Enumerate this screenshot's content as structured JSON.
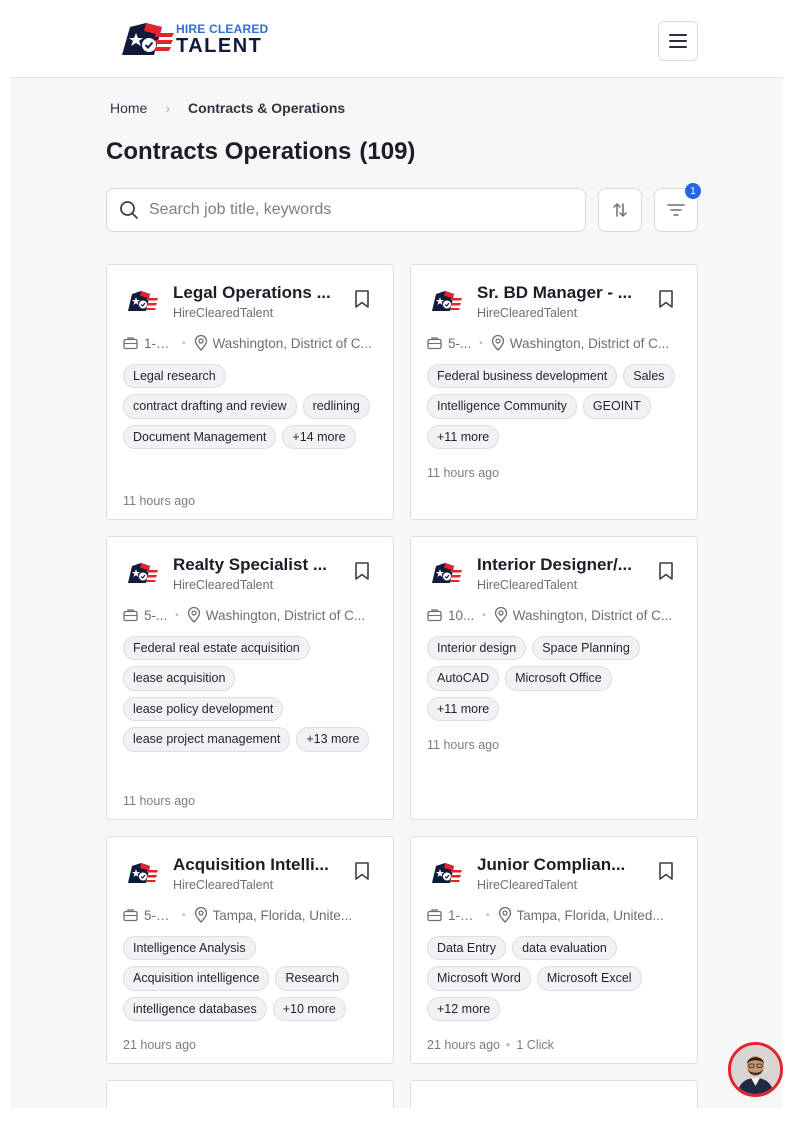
{
  "brand": {
    "line1": "HIRE CLEARED",
    "line2": "TALENT"
  },
  "breadcrumb": {
    "home": "Home",
    "separator": "›",
    "current": "Contracts & Operations"
  },
  "page": {
    "title": "Contracts Operations",
    "count": "(109)"
  },
  "search": {
    "placeholder": "Search job title, keywords"
  },
  "filter": {
    "badge": "1"
  },
  "colors": {
    "accent": "#2563eb",
    "brand_navy": "#0f1b3d",
    "brand_blue": "#2f6fd1",
    "brand_red": "#e0262c"
  },
  "cards": [
    {
      "title": "Legal Operations ...",
      "company": "HireClearedTalent",
      "experience": "1-3...",
      "location": "Washington, District of C...",
      "tags": [
        "Legal research",
        "contract drafting and review",
        "redlining",
        "Document Management",
        "+14 more"
      ],
      "posted": "11 hours ago",
      "extra": ""
    },
    {
      "title": "Sr. BD Manager - ...",
      "company": "HireClearedTalent",
      "experience": "5-...",
      "location": "Washington, District of C...",
      "tags": [
        "Federal business development",
        "Sales",
        "Intelligence Community",
        "GEOINT",
        "+11 more"
      ],
      "posted": "11 hours ago",
      "extra": ""
    },
    {
      "title": "Realty Specialist ...",
      "company": "HireClearedTalent",
      "experience": "5-...",
      "location": "Washington, District of C...",
      "tags": [
        "Federal real estate acquisition",
        "lease acquisition",
        "lease policy development",
        "lease project management",
        "+13 more"
      ],
      "posted": "11 hours ago",
      "extra": ""
    },
    {
      "title": "Interior Designer/...",
      "company": "HireClearedTalent",
      "experience": "10...",
      "location": "Washington, District of C...",
      "tags": [
        "Interior design",
        "Space Planning",
        "AutoCAD",
        "Microsoft Office",
        "+11 more"
      ],
      "posted": "11 hours ago",
      "extra": ""
    },
    {
      "title": "Acquisition Intelli...",
      "company": "HireClearedTalent",
      "experience": "5-7 y...",
      "location": "Tampa, Florida, Unite...",
      "tags": [
        "Intelligence Analysis",
        "Acquisition intelligence",
        "Research",
        "intelligence databases",
        "+10 more"
      ],
      "posted": "21 hours ago",
      "extra": ""
    },
    {
      "title": "Junior Complian...",
      "company": "HireClearedTalent",
      "experience": "1-3 y...",
      "location": "Tampa, Florida, United...",
      "tags": [
        "Data Entry",
        "data evaluation",
        "Microsoft Word",
        "Microsoft Excel",
        "+12 more"
      ],
      "posted": "21 hours ago",
      "extra": "1 Click"
    }
  ]
}
